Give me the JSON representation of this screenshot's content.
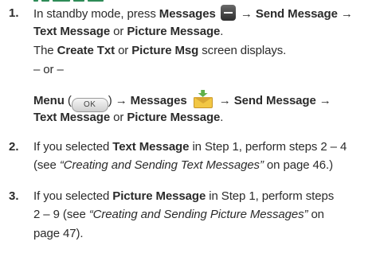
{
  "steps": [
    {
      "number": "1.",
      "line1": {
        "pre": "In standby mode, press ",
        "b1": "Messages",
        "icon": "minus-key-icon",
        "mid": " → ",
        "b2": "Send Message",
        "post": " →"
      },
      "line2": {
        "b1": "Text Message",
        "mid": " or ",
        "b2": "Picture Message",
        "post": "."
      },
      "line3": {
        "pre": "The ",
        "b1": "Create Txt",
        "mid": " or ",
        "b2": "Picture Msg",
        "post": " screen displays."
      },
      "or": "– or –",
      "line5": {
        "b1": "Menu",
        "open": " (",
        "key": "OK",
        "close": ") → ",
        "b2": "Messages",
        "icon": "messages-envelope-icon",
        "mid": " → ",
        "b3": "Send Message",
        "post": " →"
      },
      "line6": {
        "b1": "Text Message",
        "mid": " or ",
        "b2": "Picture Message",
        "post": "."
      }
    },
    {
      "number": "2.",
      "line1": {
        "pre": "If you selected ",
        "b1": "Text Message",
        "post": " in Step 1, perform steps 2 – 4"
      },
      "line2": {
        "pre": "(see ",
        "i1": "“Creating and Sending Text Messages”",
        "post": " on page 46.)"
      }
    },
    {
      "number": "3.",
      "line1": {
        "pre": "If you selected ",
        "b1": "Picture Message",
        "post": " in Step 1, perform steps"
      },
      "line2": {
        "pre": "2 – 9 (see ",
        "i1": "“Creating and Sending Picture Messages”",
        "post": " on"
      },
      "line3": {
        "pre": "page 47)."
      }
    }
  ],
  "accent_color": "#2e8b57"
}
